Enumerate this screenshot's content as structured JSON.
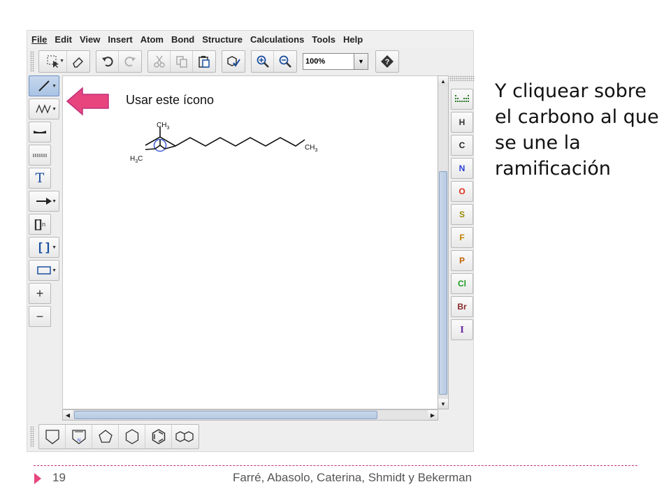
{
  "menubar": {
    "items": [
      "File",
      "Edit",
      "View",
      "Insert",
      "Atom",
      "Bond",
      "Structure",
      "Calculations",
      "Tools",
      "Help"
    ]
  },
  "toolbar": {
    "zoom_value": "100%",
    "icons": [
      "select-icon",
      "eraser-icon",
      "undo-icon",
      "redo-icon",
      "cut-icon",
      "copy-icon",
      "paste-icon",
      "clean-icon",
      "zoom-in-icon",
      "zoom-out-icon",
      "help-icon"
    ]
  },
  "left_tools": {
    "text_tool": "T",
    "bracket_tool": "[]",
    "bracket_sub": "n",
    "sgroup_tool": "[ ]",
    "charge_plus": "+",
    "charge_minus": "−"
  },
  "elements": [
    {
      "symbol": "H",
      "color": "#333333"
    },
    {
      "symbol": "C",
      "color": "#222222"
    },
    {
      "symbol": "N",
      "color": "#2b3fd6"
    },
    {
      "symbol": "O",
      "color": "#e0301e"
    },
    {
      "symbol": "S",
      "color": "#9a8a00"
    },
    {
      "symbol": "F",
      "color": "#c08000"
    },
    {
      "symbol": "P",
      "color": "#c06000"
    },
    {
      "symbol": "Cl",
      "color": "#1f9a1f"
    },
    {
      "symbol": "Br",
      "color": "#8a2a2a"
    },
    {
      "symbol": "I",
      "color": "#6a2aa0"
    }
  ],
  "molecule": {
    "labels": {
      "ch3_top": "CH",
      "ch3_top_sub": "3",
      "h3c_left_h": "H",
      "h3c_left_sub": "3",
      "h3c_left_c": "C",
      "ch3_right": "CH",
      "ch3_right_sub": "3"
    }
  },
  "annotation": {
    "hint": "Usar este ícono",
    "side_text": "Y cliquear sobre el carbono al que se une la ramificación"
  },
  "footer": {
    "page_number": "19",
    "authors": "Farré, Abasolo, Caterina, Shmidt y Bekerman"
  },
  "colors": {
    "accent_pink": "#e8457f",
    "footer_line": "#c0307a",
    "selection_blue": "#3a5bd6"
  }
}
